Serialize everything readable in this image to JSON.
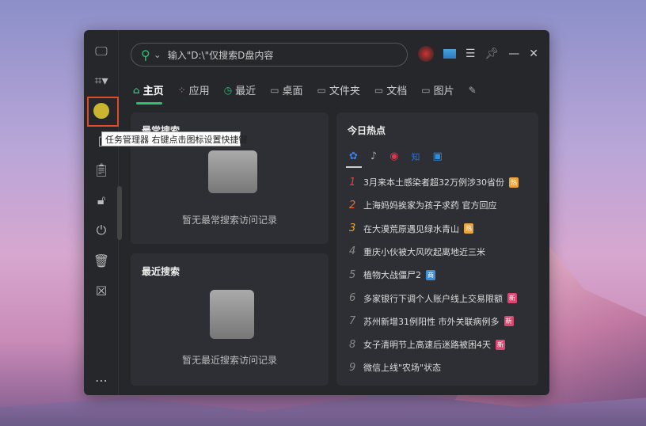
{
  "search": {
    "placeholder": "输入\"D:\\\"仅搜索D盘内容"
  },
  "tooltip": "任务管理器 右键点击图标设置快捷键",
  "tabs": [
    {
      "label": "主页",
      "icon": "⌂"
    },
    {
      "label": "应用",
      "icon": "⁘"
    },
    {
      "label": "最近",
      "icon": "◷"
    },
    {
      "label": "桌面",
      "icon": "▭"
    },
    {
      "label": "文件夹",
      "icon": "▭"
    },
    {
      "label": "文档",
      "icon": "▭"
    },
    {
      "label": "图片",
      "icon": "▭"
    }
  ],
  "frequent": {
    "title": "最常搜索",
    "empty": "暂无最常搜索访问记录"
  },
  "recent": {
    "title": "最近搜索",
    "empty": "暂无最近搜索访问记录"
  },
  "hot": {
    "title": "今日热点",
    "sources": [
      "baidu",
      "douyin",
      "weibo",
      "zhihu",
      "bilibili"
    ],
    "items": [
      {
        "rank": "1",
        "text": "3月来本土感染者超32万例涉30省份",
        "badge": "热",
        "badge_color": "#e8a33a",
        "rank_color": "#e0453a"
      },
      {
        "rank": "2",
        "text": "上海妈妈挨家为孩子求药 官方回应",
        "badge": "",
        "rank_color": "#ef6a2a"
      },
      {
        "rank": "3",
        "text": "在大漠荒原遇见绿水青山",
        "badge": "热",
        "badge_color": "#e8a33a",
        "rank_color": "#f0a530"
      },
      {
        "rank": "4",
        "text": "重庆小伙被大风吹起离地近三米",
        "badge": ""
      },
      {
        "rank": "5",
        "text": "植物大战僵尸2",
        "badge": "商",
        "badge_color": "#3b8fd9"
      },
      {
        "rank": "6",
        "text": "多家银行下调个人账户线上交易限额",
        "badge": "新",
        "badge_color": "#d9486e"
      },
      {
        "rank": "7",
        "text": "苏州新增31例阳性 市外关联病例多",
        "badge": "新",
        "badge_color": "#d9486e"
      },
      {
        "rank": "8",
        "text": "女子清明节上高速后迷路被困4天",
        "badge": "新",
        "badge_color": "#d9486e"
      },
      {
        "rank": "9",
        "text": "微信上线\"农场\"状态",
        "badge": ""
      }
    ]
  }
}
